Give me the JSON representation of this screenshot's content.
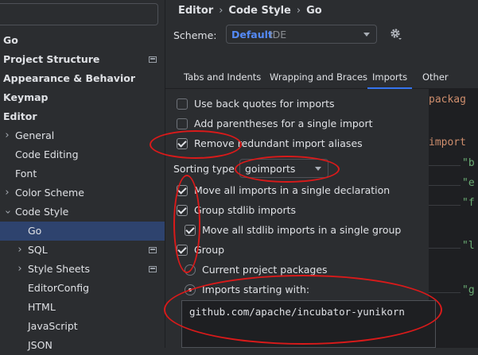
{
  "sidebar": {
    "items": [
      {
        "label": "Go",
        "bold": true
      },
      {
        "label": "Project Structure",
        "bold": true
      },
      {
        "label": "Appearance & Behavior",
        "bold": true
      },
      {
        "label": "Keymap",
        "bold": true
      },
      {
        "label": "Editor",
        "bold": true
      },
      {
        "label": "General"
      },
      {
        "label": "Code Editing"
      },
      {
        "label": "Font"
      },
      {
        "label": "Color Scheme"
      },
      {
        "label": "Code Style"
      },
      {
        "label": "Go"
      },
      {
        "label": "SQL"
      },
      {
        "label": "Style Sheets"
      },
      {
        "label": "EditorConfig"
      },
      {
        "label": "HTML"
      },
      {
        "label": "JavaScript"
      },
      {
        "label": "JSON"
      }
    ]
  },
  "breadcrumb": [
    "Editor",
    "Code Style",
    "Go"
  ],
  "scheme": {
    "label": "Scheme:",
    "value": "Default",
    "sub": "IDE"
  },
  "tabs": [
    "Tabs and Indents",
    "Wrapping and Braces",
    "Imports",
    "Other"
  ],
  "active_tab": "Imports",
  "options": {
    "back_quotes": {
      "label": "Use back quotes for imports",
      "checked": false
    },
    "add_parens": {
      "label": "Add parentheses for a single import",
      "checked": false
    },
    "remove_aliases": {
      "label": "Remove redundant import aliases",
      "checked": true
    },
    "sorting_label": "Sorting type",
    "sorting_value": "goimports",
    "move_all": {
      "label": "Move all imports in a single declaration",
      "checked": true
    },
    "group_stdlib": {
      "label": "Group stdlib imports",
      "checked": true
    },
    "move_stdlib": {
      "label": "Move all stdlib imports in a single group",
      "checked": true
    },
    "group": {
      "label": "Group",
      "checked": true
    },
    "current_project": {
      "label": "Current project packages",
      "checked": false
    },
    "imports_starting": {
      "label": "Imports starting with:",
      "checked": true
    },
    "imports_prefix": "github.com/apache/incubator-yunikorn"
  },
  "preview": {
    "line1": "packag",
    "line2": "import",
    "strs": [
      "\"b",
      "\"e",
      "\"f",
      "\"l",
      "\"g"
    ]
  },
  "colors": {
    "annotation": "#d91a1a",
    "accent": "#548af7",
    "selection": "#2e436e"
  }
}
